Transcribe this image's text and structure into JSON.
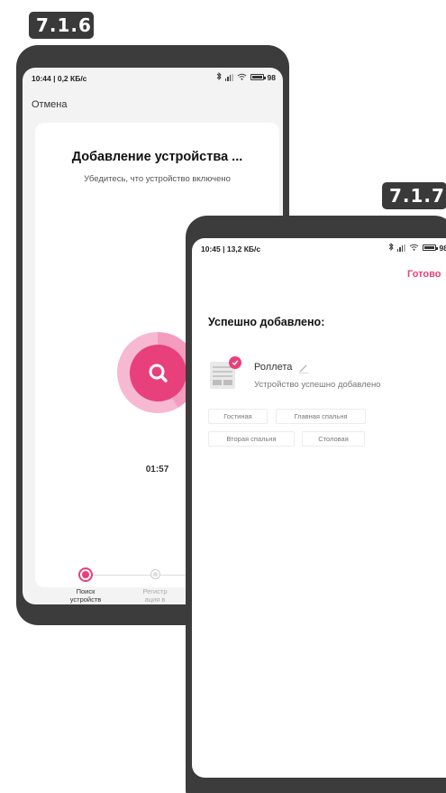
{
  "badges": {
    "first": "7.1.6",
    "second": "7.1.7"
  },
  "screen1": {
    "status": {
      "time": "10:44 | 0,2 КБ/с",
      "battery": "98"
    },
    "cancel_label": "Отмена",
    "title": "Добавление устройства ...",
    "subtitle": "Убедитесь, что устройство включено",
    "timer": "01:57",
    "steps": [
      {
        "label": "Поиск устройств",
        "state": "active"
      },
      {
        "label": "Регистр ация в облаке",
        "state": "pending"
      }
    ]
  },
  "screen2": {
    "status": {
      "time": "10:45 | 13,2 КБ/с",
      "battery": "98"
    },
    "done_label": "Готово",
    "success_title": "Успешно добавлено:",
    "device": {
      "name": "Роллета",
      "description": "Устройство успешно добавлено",
      "icon": "roller-shutter-icon"
    },
    "rooms": [
      "Гостиная",
      "Главная спальня",
      "Вторая спальня",
      "Столовая"
    ]
  },
  "colors": {
    "accent": "#e8407b",
    "frame": "#3c3c3c",
    "badge": "#3a3a3a"
  }
}
